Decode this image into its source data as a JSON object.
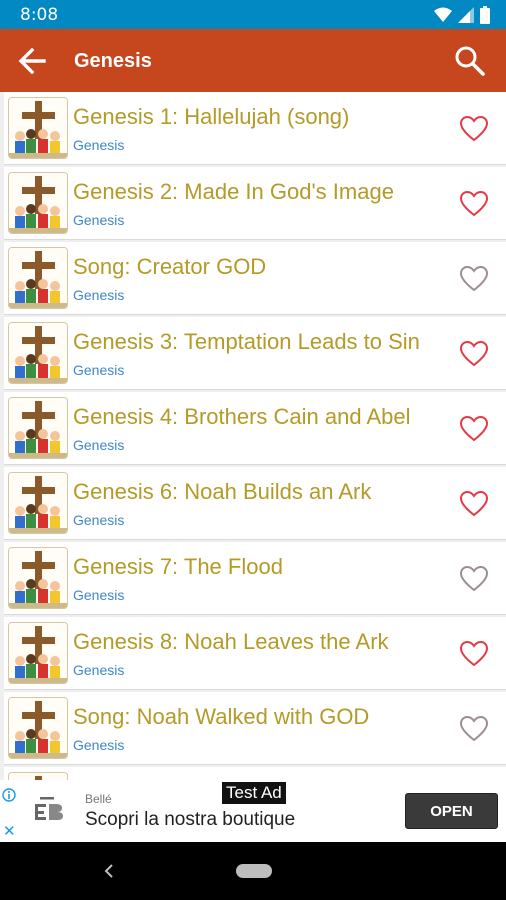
{
  "status": {
    "time": "8:08"
  },
  "toolbar": {
    "title": "Genesis",
    "back_icon": "arrow-left-icon",
    "search_icon": "search-icon"
  },
  "list": {
    "items": [
      {
        "title": "Genesis 1: Hallelujah (song)",
        "subtitle": "Genesis",
        "favorite": true
      },
      {
        "title": "Genesis 2: Made In God's Image",
        "subtitle": "Genesis",
        "favorite": true
      },
      {
        "title": "Song: Creator GOD",
        "subtitle": "Genesis",
        "favorite": false
      },
      {
        "title": "Genesis 3: Temptation Leads to Sin",
        "subtitle": "Genesis",
        "favorite": true
      },
      {
        "title": "Genesis 4: Brothers Cain and Abel",
        "subtitle": "Genesis",
        "favorite": true
      },
      {
        "title": "Genesis 6: Noah Builds an Ark",
        "subtitle": "Genesis",
        "favorite": true
      },
      {
        "title": "Genesis 7: The Flood",
        "subtitle": "Genesis",
        "favorite": false
      },
      {
        "title": "Genesis 8: Noah Leaves the Ark",
        "subtitle": "Genesis",
        "favorite": true
      },
      {
        "title": "Song: Noah Walked with GOD",
        "subtitle": "Genesis",
        "favorite": false
      },
      {
        "title": "",
        "subtitle": "",
        "favorite": false
      }
    ]
  },
  "ad": {
    "label": "Test Ad",
    "brand": "Bellé",
    "text": "Scopri la nostra boutique",
    "cta": "OPEN",
    "close": "✕"
  },
  "colors": {
    "status_bar": "#0288c2",
    "app_bar": "#c6461e",
    "title_text": "#b49a27",
    "subtitle_text": "#3f87c8",
    "heart_active": "#e53946",
    "heart_inactive": "#9e8c95"
  }
}
